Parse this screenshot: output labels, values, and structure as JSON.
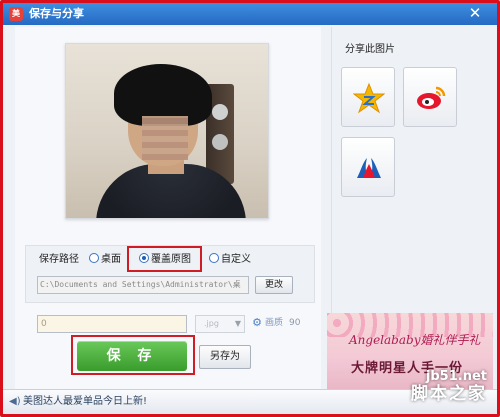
{
  "window": {
    "title": "保存与分享",
    "app_icon": "meitu-logo-icon",
    "close_glyph": "✕"
  },
  "save_path": {
    "label": "保存路径",
    "options": [
      {
        "label": "桌面",
        "checked": false
      },
      {
        "label": "覆盖原图",
        "checked": true
      },
      {
        "label": "自定义",
        "checked": false
      }
    ],
    "path_value": "C:\\Documents and Settings\\Administrator\\桌",
    "change_button": "更改"
  },
  "output": {
    "filename_value": "0",
    "format_value": ".jpg",
    "quality_label": "画质",
    "quality_value": "90"
  },
  "buttons": {
    "save": "保 存",
    "save_as": "另存为"
  },
  "share": {
    "title": "分享此图片",
    "targets": [
      {
        "icon": "qzone-star-icon"
      },
      {
        "icon": "weibo-icon"
      },
      {
        "icon": "renren-icon"
      }
    ]
  },
  "ad": {
    "line1": "Angelababy婚礼伴手礼",
    "line2": "大牌明星人手一份"
  },
  "status": {
    "icon": "speaker-icon",
    "text": "美图达人最爱单品今日上新!"
  },
  "watermark": {
    "top": "jb51.net",
    "bottom": "脚本之家"
  },
  "colors": {
    "titlebar": "#2f7dd6",
    "highlight": "#d01c24",
    "save_button": "#4bb43c"
  }
}
